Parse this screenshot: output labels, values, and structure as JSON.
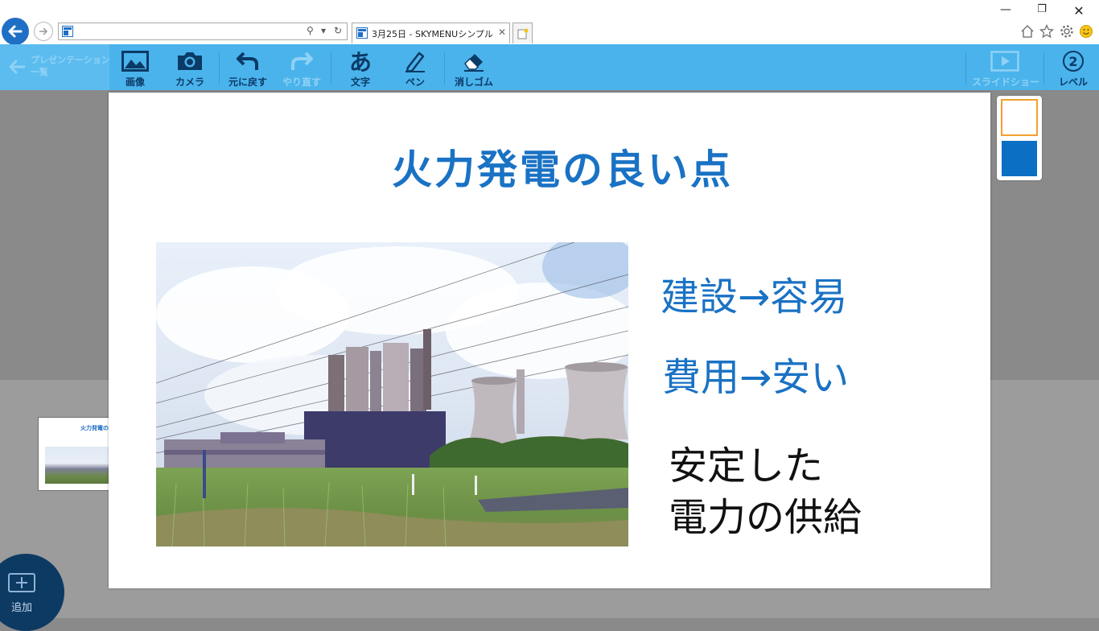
{
  "browser": {
    "tab_title": "3月25日 - SKYMENUシンプル...",
    "address_value": "",
    "window_controls": [
      "minimize-icon",
      "restore-icon",
      "close-icon"
    ],
    "tool_icons": [
      "home-icon",
      "favorites-star-icon",
      "settings-gear-icon",
      "smiley-feedback-icon"
    ]
  },
  "toolbar": {
    "back_list_label": "プレゼンテーション\n一覧",
    "image_label": "画像",
    "camera_label": "カメラ",
    "undo_label": "元に戻す",
    "redo_label": "やり直す",
    "text_label": "文字",
    "text_icon_glyph": "あ",
    "pen_label": "ペン",
    "eraser_label": "消しゴム",
    "slideshow_label": "スライドショー",
    "level_label": "レベル",
    "level_number": "2"
  },
  "slide": {
    "title": "火力発電の良い点",
    "point1": "建設→容易",
    "point2": "費用→安い",
    "point3": "安定した\n電力の供給",
    "photo": "thermal-power-plant-photo"
  },
  "thumbnail": {
    "title": "火力発電の"
  },
  "add_button": {
    "label": "追加"
  },
  "palette": {
    "colors": [
      "#ffffff",
      "#0b6fc4"
    ],
    "selected": "#ffffff"
  },
  "colors": {
    "toolbar": "#4ab3ec",
    "title_blue": "#1a72c4",
    "browser_back": "#1f6fc5"
  }
}
